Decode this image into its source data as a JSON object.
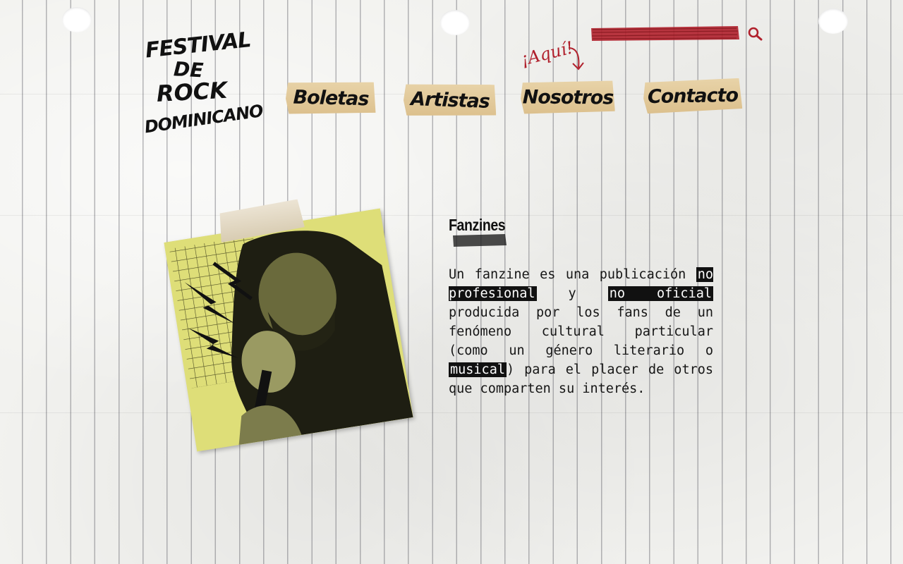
{
  "logo": {
    "lines": [
      "FESTIVAL",
      "DE",
      "ROCK",
      "DOMINICANO"
    ]
  },
  "nav": {
    "items": [
      {
        "label": "Boletas"
      },
      {
        "label": "Artistas"
      },
      {
        "label": "Nosotros"
      },
      {
        "label": "Contacto"
      }
    ],
    "active_marker": "¡Aquí!"
  },
  "search": {
    "placeholder": "",
    "value": "",
    "icon": "search-icon",
    "scribble_color": "#b0202c"
  },
  "article": {
    "title": "Fanzines",
    "body": {
      "t1": "Un fanzine es una publicación ",
      "h1": "no profesional",
      "t2": " y ",
      "h2": "no oficial",
      "t3": " producida por los fans de un fenómeno cultural particular (como un género literario o ",
      "h3": "musical",
      "t4": ") para el placer de otros que comparten su interés."
    }
  },
  "colors": {
    "tape": "#dcc08d",
    "photo_tint": "#dede78",
    "ink": "#111111",
    "accent_red": "#b0202c"
  }
}
